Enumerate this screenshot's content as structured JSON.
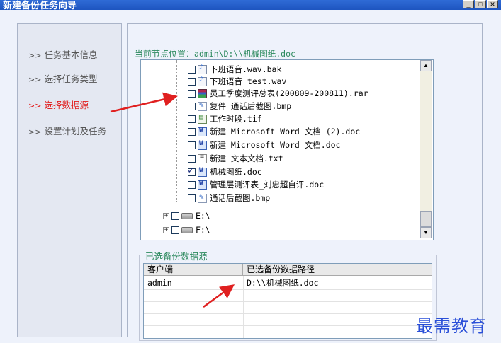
{
  "window": {
    "title": "新建备份任务向导",
    "buttons": {
      "minimize": "_",
      "maximize": "□",
      "close": "✕"
    }
  },
  "nav": {
    "items": [
      {
        "label": "选择任务类型"
      },
      {
        "label": "任务基本信息"
      },
      {
        "label": "选择数据源",
        "active": true
      },
      {
        "label": "设置计划及任务"
      }
    ],
    "arrow": ">>"
  },
  "current_node": {
    "label": "当前节点位置：",
    "value": "admin\\D:\\\\机械图纸.doc"
  },
  "tree": {
    "files": [
      {
        "name": "下班语音.wav.bak",
        "icon": "wav-file-icon",
        "checked": false
      },
      {
        "name": "下班语音_test.wav",
        "icon": "audio-file-icon",
        "checked": false
      },
      {
        "name": "员工季度测评总表(200809-200811).rar",
        "icon": "rar-archive-icon",
        "checked": false
      },
      {
        "name": "复件 通话后截图.bmp",
        "icon": "bitmap-file-icon",
        "checked": false
      },
      {
        "name": "工作时段.tif",
        "icon": "image-file-icon",
        "checked": false
      },
      {
        "name": "新建 Microsoft Word 文档 (2).doc",
        "icon": "word-doc-icon",
        "checked": false
      },
      {
        "name": "新建 Microsoft Word 文档.doc",
        "icon": "word-doc-icon",
        "checked": false
      },
      {
        "name": "新建 文本文档.txt",
        "icon": "text-file-icon",
        "checked": false
      },
      {
        "name": "机械图纸.doc",
        "icon": "word-doc-icon",
        "checked": true
      },
      {
        "name": "管理层测评表_刘忠超自评.doc",
        "icon": "word-doc-icon",
        "checked": false
      },
      {
        "name": "通话后截图.bmp",
        "icon": "bitmap-file-icon",
        "checked": false
      }
    ],
    "drives": [
      {
        "name": "E:\\",
        "expander": "+"
      },
      {
        "name": "F:\\",
        "expander": "+"
      }
    ]
  },
  "selected_sources": {
    "group_label": "已选备份数据源",
    "columns": [
      "客户端",
      "已选备份数据路径"
    ],
    "rows": [
      {
        "client": "admin",
        "path": "D:\\\\机械图纸.doc"
      }
    ]
  },
  "scrollbar": {
    "up": "▲",
    "down": "▼"
  },
  "watermark": "最需教育",
  "colors": {
    "active_nav": "#e21818",
    "label_green": "#2c8a5e",
    "annotation_arrow": "#e02020",
    "watermark": "#2a4fd8"
  }
}
